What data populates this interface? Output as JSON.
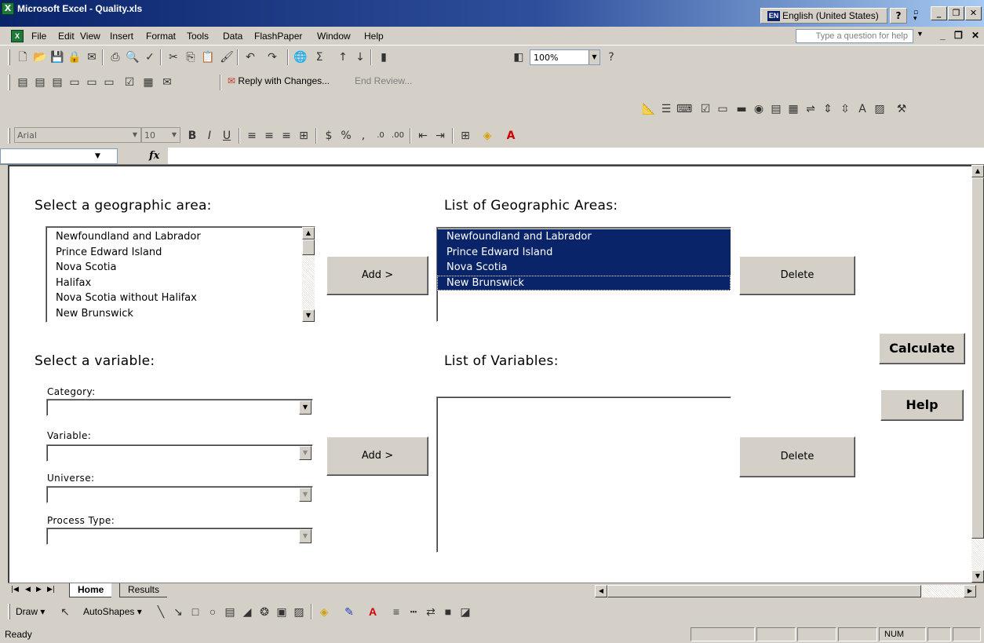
{
  "window": {
    "title": "Microsoft Excel - Quality.xls",
    "app_icon": "excel-icon",
    "language": {
      "code": "EN",
      "label": "English (United States)"
    }
  },
  "menu": {
    "items": [
      "File",
      "Edit",
      "View",
      "Insert",
      "Format",
      "Tools",
      "Data",
      "FlashPaper",
      "Window",
      "Help"
    ],
    "question_placeholder": "Type a question for help"
  },
  "standard_toolbar": {
    "zoom": "100%"
  },
  "reviewing_toolbar": {
    "reply_label": "Reply with Changes...",
    "end_review_label": "End Review..."
  },
  "formatting_toolbar": {
    "font": "Arial",
    "size": "10"
  },
  "formula_bar": {
    "fx": "fx"
  },
  "form": {
    "geo": {
      "select_heading": "Select a geographic area:",
      "list_heading": "List of Geographic Areas:",
      "available": [
        "Newfoundland and Labrador",
        "Prince Edward Island",
        "Nova Scotia",
        "Halifax",
        "Nova Scotia without Halifax",
        "New Brunswick"
      ],
      "selected": [
        "Newfoundland and Labrador",
        "Prince Edward Island",
        "Nova Scotia",
        "New Brunswick"
      ],
      "add_label": "Add >",
      "delete_label": "Delete"
    },
    "var": {
      "select_heading": "Select a variable:",
      "list_heading": "List of Variables:",
      "category_label": "Category:",
      "variable_label": "Variable:",
      "universe_label": "Universe:",
      "process_label": "Process Type:",
      "add_label": "Add >",
      "delete_label": "Delete"
    },
    "calculate_label": "Calculate",
    "help_label": "Help"
  },
  "sheet_tabs": [
    "Home",
    "Results"
  ],
  "active_tab": "Home",
  "drawing_toolbar": {
    "draw_label": "Draw",
    "autoshapes_label": "AutoShapes"
  },
  "status": {
    "text": "Ready",
    "num": "NUM"
  }
}
